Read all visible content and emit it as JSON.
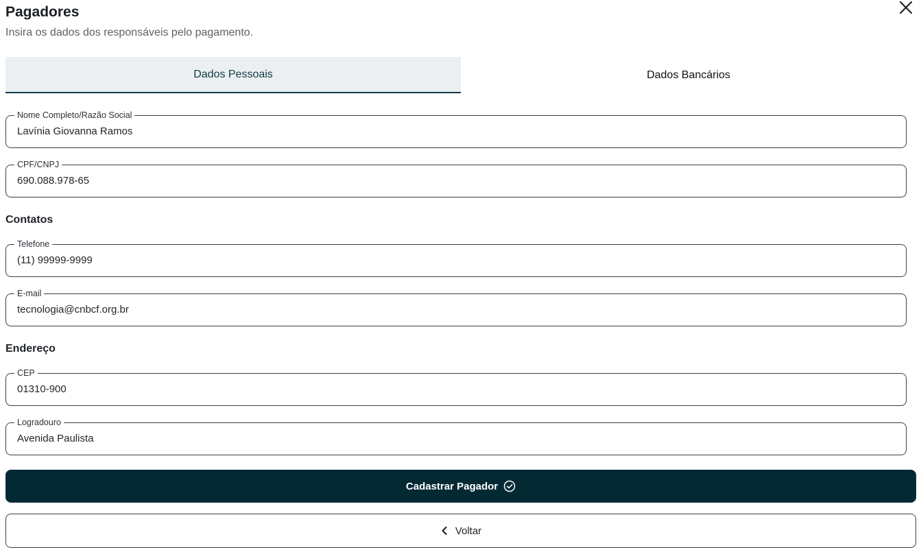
{
  "header": {
    "title": "Pagadores",
    "subtitle": "Insira os dados dos responsáveis pelo pagamento.",
    "close_icon": "close-icon"
  },
  "tabs": [
    {
      "label": "Dados Pessoais",
      "active": true
    },
    {
      "label": "Dados Bancários",
      "active": false
    }
  ],
  "fields": {
    "nome": {
      "label": "Nome Completo/Razão Social",
      "value": "Lavínia Giovanna Ramos"
    },
    "cpf": {
      "label": "CPF/CNPJ",
      "value": "690.088.978-65"
    },
    "telefone": {
      "label": "Telefone",
      "value": "(11) 99999-9999"
    },
    "email": {
      "label": "E-mail",
      "value": "tecnologia@cnbcf.org.br"
    },
    "cep": {
      "label": "CEP",
      "value": "01310-900"
    },
    "logradouro": {
      "label": "Logradouro",
      "value": "Avenida Paulista"
    }
  },
  "sections": {
    "contatos": "Contatos",
    "endereco": "Endereço"
  },
  "actions": {
    "submit_label": "Cadastrar Pagador",
    "submit_icon": "check-circle-icon",
    "back_label": "Voltar",
    "back_icon": "chevron-left-icon"
  },
  "colors": {
    "primary": "#032a33",
    "tab_active_bg": "#ebeff1",
    "border": "#3a3f45"
  }
}
